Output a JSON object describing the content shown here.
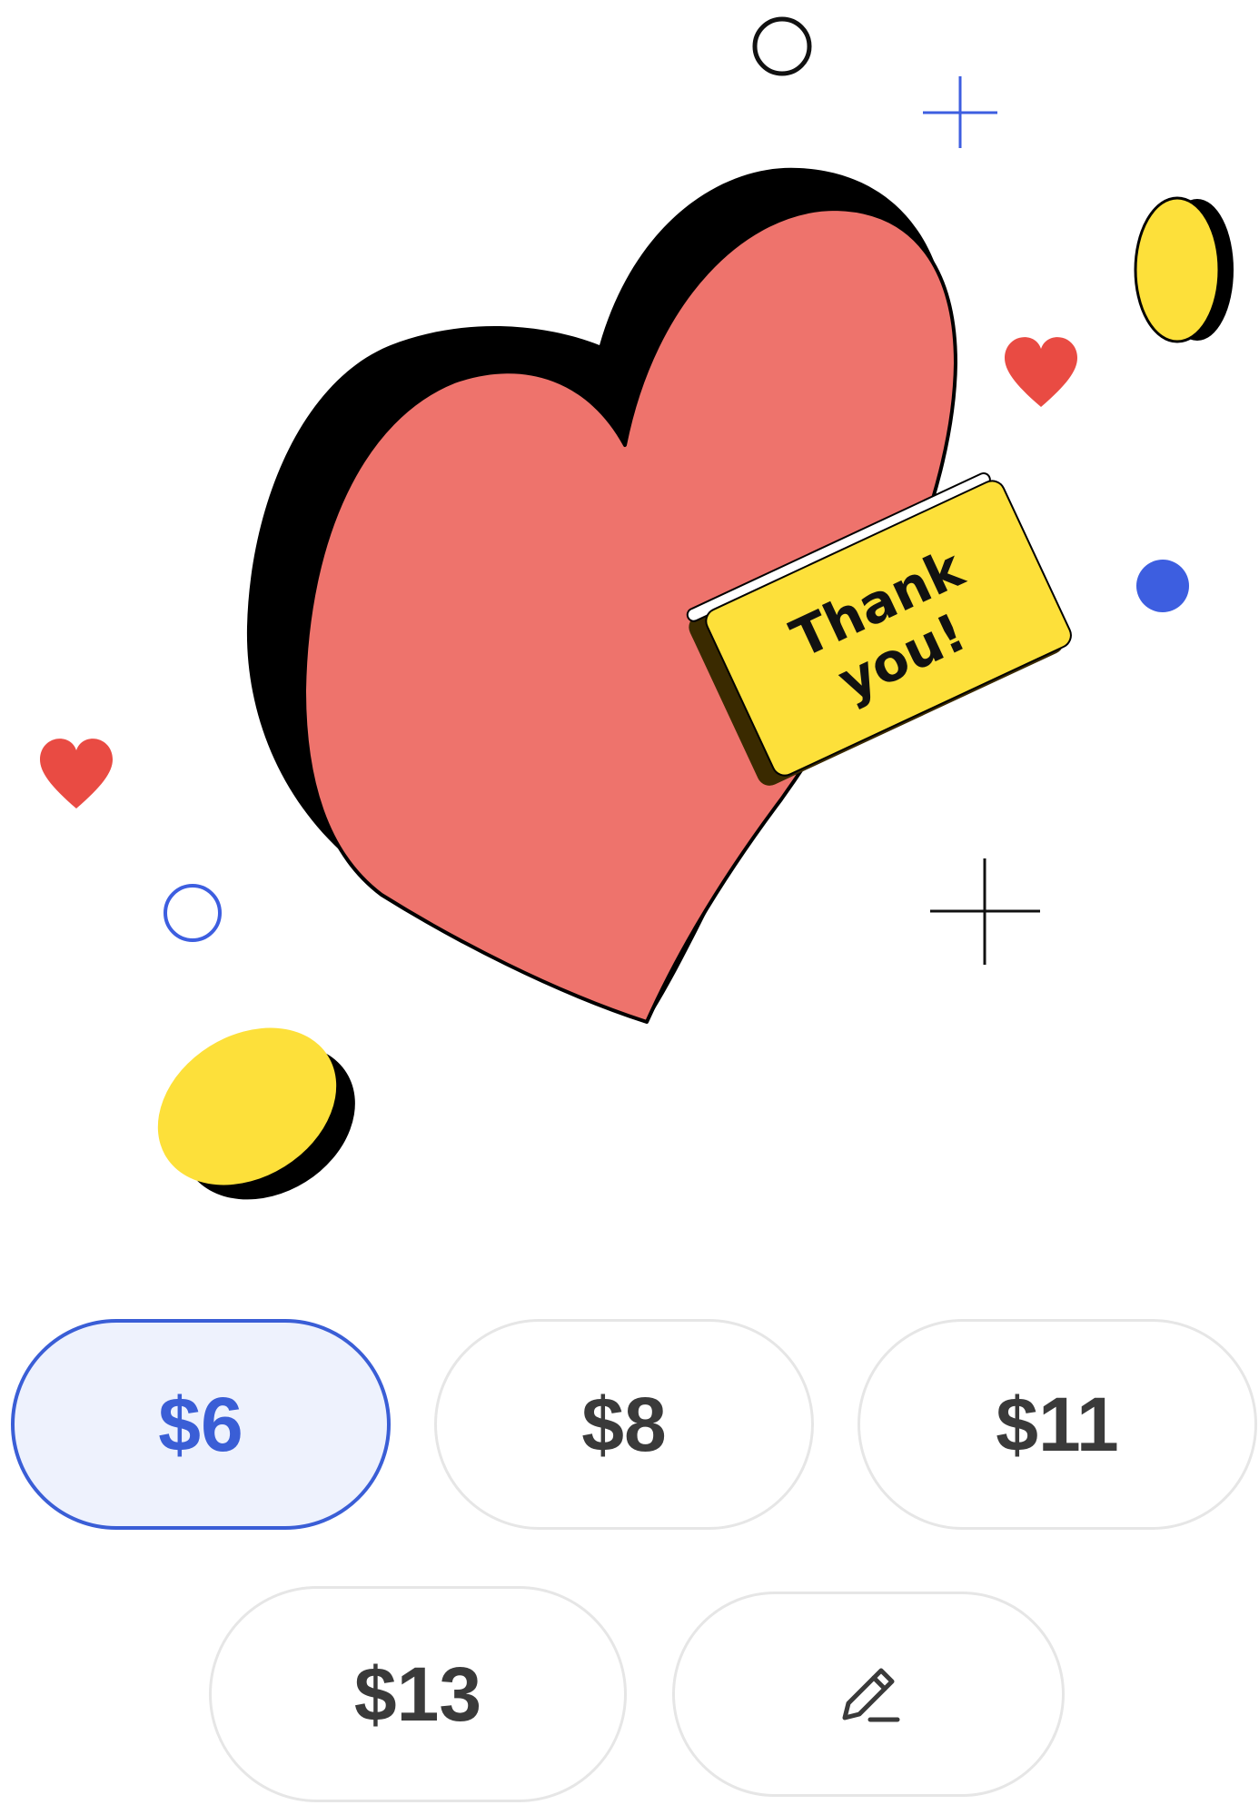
{
  "illustration": {
    "sticker_text_line1": "Thank",
    "sticker_text_line2": "you!",
    "colors": {
      "heart": "#ee736c",
      "outline": "#000000",
      "coin": "#fde03a",
      "sticker": "#fde03a",
      "small_heart": "#e94b43",
      "accent_blue": "#3d5ee0"
    }
  },
  "amount_options": {
    "option_1": "$6",
    "option_2": "$8",
    "option_3": "$11",
    "option_4": "$13",
    "custom_icon": "pencil-icon",
    "selected": "$6"
  },
  "colors": {
    "selected_border": "#3a5ed6",
    "selected_background": "#eef2fd",
    "button_border": "#e6e6e6",
    "button_text": "#3a3a3a"
  }
}
